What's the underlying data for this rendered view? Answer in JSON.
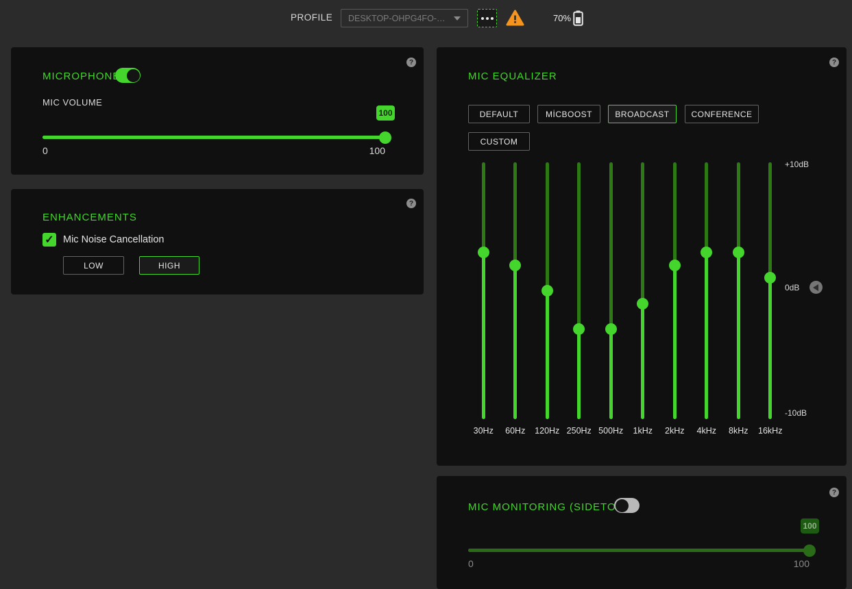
{
  "colors": {
    "accent": "#44d62c",
    "accent_dark": "#2d7a15",
    "disabled_green": "#2a6b17",
    "warning_orange": "#f7941d",
    "card_bg": "#101010",
    "page_bg": "#2b2b2b"
  },
  "icons": {
    "help": "?",
    "check": "✓",
    "battery": "battery-70",
    "warning": "!",
    "more": "•••"
  },
  "top_bar": {
    "profile_label": "PROFILE",
    "profile_value": "DESKTOP-OHPG4FO-…",
    "battery_percent": "70%"
  },
  "microphone": {
    "title": "MICROPHONE",
    "toggle_on": true,
    "volume_label": "MIC VOLUME",
    "volume_value": "100",
    "volume_numeric": 100,
    "min_label": "0",
    "max_label": "100"
  },
  "enhancements": {
    "title": "ENHANCEMENTS",
    "checkbox_label": "Mic Noise Cancellation",
    "checkbox_checked": true,
    "options": [
      "LOW",
      "HIGH"
    ],
    "selected_option": "HIGH"
  },
  "equalizer": {
    "title": "MIC EQUALIZER",
    "presets": [
      "DEFAULT",
      "MİCBOOST",
      "BROADCAST",
      "CONFERENCE",
      "CUSTOM"
    ],
    "selected_preset": "BROADCAST",
    "scale": {
      "top": "+10dB",
      "mid": "0dB",
      "bottom": "-10dB"
    },
    "db_range": [
      -10,
      10
    ],
    "bands": [
      {
        "freq": "30Hz",
        "db": 3
      },
      {
        "freq": "60Hz",
        "db": 2
      },
      {
        "freq": "120Hz",
        "db": 0
      },
      {
        "freq": "250Hz",
        "db": -3
      },
      {
        "freq": "500Hz",
        "db": -3
      },
      {
        "freq": "1kHz",
        "db": -1
      },
      {
        "freq": "2kHz",
        "db": 2
      },
      {
        "freq": "4kHz",
        "db": 3
      },
      {
        "freq": "8kHz",
        "db": 3
      },
      {
        "freq": "16kHz",
        "db": 1
      }
    ]
  },
  "sidetone": {
    "title": "MIC MONITORING (SIDETONE)",
    "toggle_on": false,
    "value": "100",
    "value_numeric": 100,
    "min_label": "0",
    "max_label": "100"
  }
}
